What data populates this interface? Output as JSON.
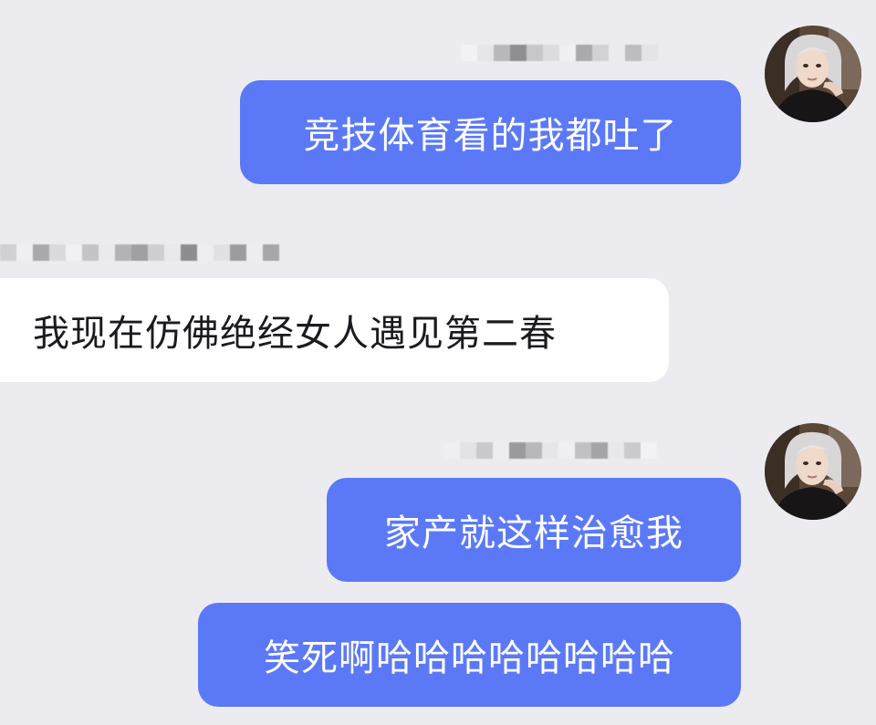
{
  "messages": [
    {
      "direction": "outgoing",
      "text": "竞技体育看的我都吐了"
    },
    {
      "direction": "incoming",
      "text": "我现在仿佛绝经女人遇见第二春"
    },
    {
      "direction": "outgoing",
      "text": "家产就这样治愈我"
    },
    {
      "direction": "outgoing",
      "text": "笑死啊哈哈哈哈哈哈哈哈"
    }
  ],
  "colors": {
    "background": "#ececf0",
    "outgoing_bubble": "#5b79f7",
    "incoming_bubble": "#ffffff"
  },
  "icons": {
    "avatar": "user-avatar-photo",
    "sender_name": "pixelated-name"
  }
}
